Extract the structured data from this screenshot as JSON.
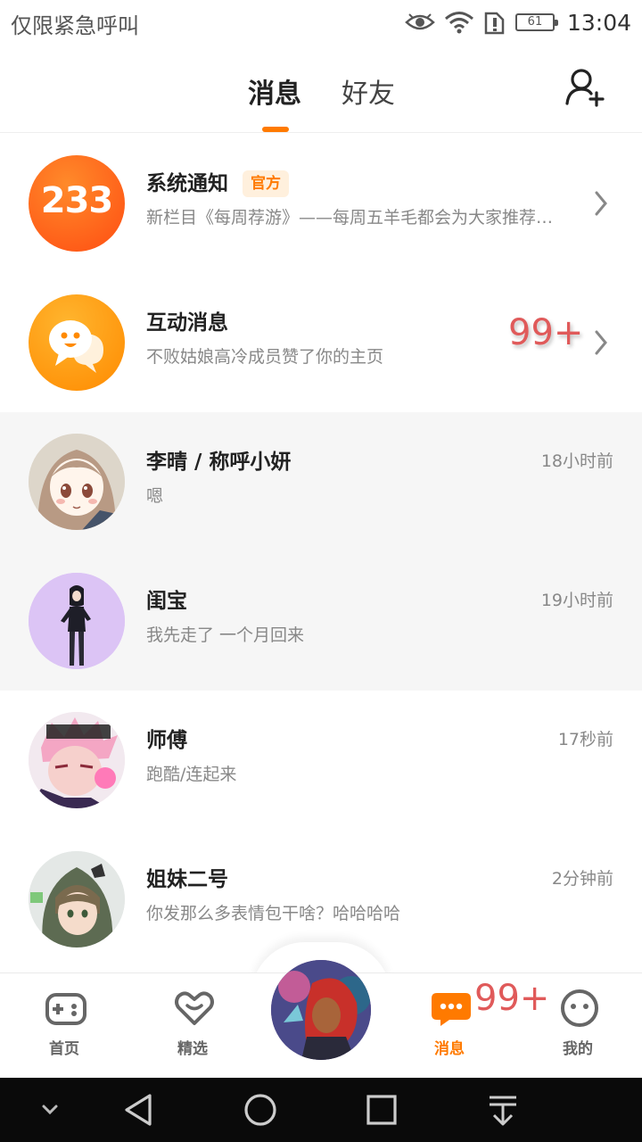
{
  "status_bar": {
    "carrier": "仅限紧急呼叫",
    "battery": "61",
    "time": "13:04"
  },
  "header": {
    "tabs": [
      {
        "label": "消息",
        "active": true
      },
      {
        "label": "好友",
        "active": false
      }
    ],
    "add_friend_icon": "add-user-icon"
  },
  "system_notice": {
    "avatar_text": "233",
    "title": "系统通知",
    "badge": "官方",
    "preview": "新栏目《每周荐游》——每周五羊毛都会为大家推荐…"
  },
  "interaction": {
    "title": "互动消息",
    "preview": "不败姑娘高冷成员赞了你的主页",
    "unread": "99+"
  },
  "conversations": [
    {
      "name": "李晴 /  称呼小妍",
      "preview": "嗯",
      "time": "18小时前",
      "pinned": true
    },
    {
      "name": "闺宝",
      "preview": "我先走了 一个月回来",
      "time": "19小时前",
      "pinned": true
    },
    {
      "name": "师傅",
      "preview": "跑酷/连起来",
      "time": "17秒前",
      "pinned": false
    },
    {
      "name": "姐妹二号",
      "preview": "你发那么多表情包干啥？哈哈哈哈",
      "time": "2分钟前",
      "pinned": false
    }
  ],
  "bottom_nav": {
    "items": [
      {
        "label": "首页",
        "icon": "gamepad-icon",
        "active": false
      },
      {
        "label": "精选",
        "icon": "heart-icon",
        "active": false
      },
      {
        "label": "消息",
        "icon": "chat-icon",
        "active": true
      },
      {
        "label": "我的",
        "icon": "smiley-icon",
        "active": false
      }
    ],
    "message_badge": "99+"
  },
  "colors": {
    "accent": "#ff7a00",
    "badge_red": "#e05a5a",
    "pinned_bg": "#f6f6f6"
  }
}
